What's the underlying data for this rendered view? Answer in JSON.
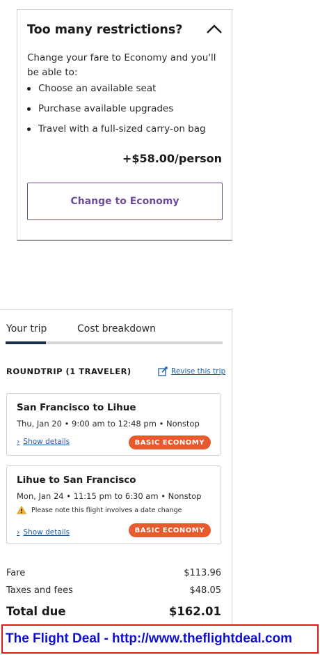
{
  "restrictions": {
    "title": "Too many restrictions?",
    "description": "Change your fare to Economy and you'll be able to:",
    "benefits": [
      "Choose an available seat",
      "Purchase available upgrades",
      "Travel with a full-sized carry-on bag"
    ],
    "price": "+$58.00/person",
    "button_label": "Change to Economy",
    "collapse_icon": "chevron-up-icon"
  },
  "trip": {
    "tabs": [
      "Your trip",
      "Cost breakdown"
    ],
    "active_tab": "Your trip",
    "roundtrip_label": "ROUNDTRIP (1 TRAVELER)",
    "revise_label": "Revise this trip",
    "flights": [
      {
        "route": "San Francisco to Lihue",
        "time": "Thu, Jan 20 • 9:00 am to 12:48 pm • Nonstop",
        "details_label": "Show details",
        "badge": "BASIC ECONOMY"
      },
      {
        "route": "Lihue to San Francisco",
        "time": "Mon, Jan 24 • 11:15 pm to 6:30 am • Nonstop",
        "warning": "Please note this flight involves a date change",
        "details_label": "Show details",
        "badge": "BASIC ECONOMY"
      }
    ],
    "costs": {
      "fare_label": "Fare",
      "fare_value": "$113.96",
      "taxes_label": "Taxes and fees",
      "taxes_value": "$48.05",
      "total_label": "Total due",
      "total_value": "$162.01"
    }
  },
  "watermark": "The Flight Deal - http://www.theflightdeal.com",
  "colors": {
    "accent_purple": "#6c4c9c",
    "badge_orange": "#e85a2e",
    "link_blue": "#1b5ea8",
    "tab_active": "#1c2e4a",
    "watermark_blue": "#1010c8",
    "watermark_red": "#e01a1a"
  }
}
